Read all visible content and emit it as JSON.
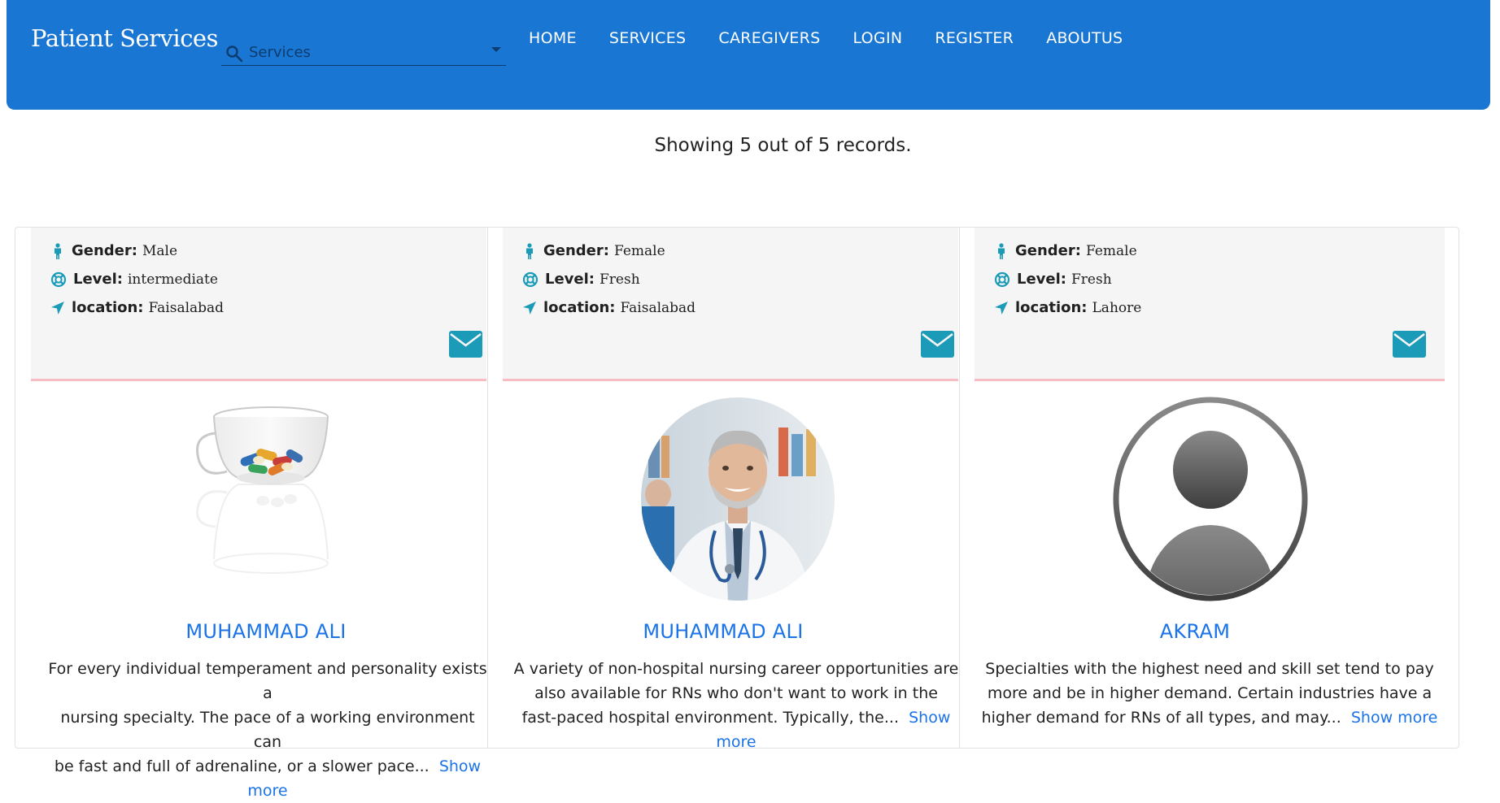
{
  "navbar": {
    "brand": "Patient Services",
    "search_placeholder": "Services",
    "links": [
      "HOME",
      "SERVICES",
      "CAREGIVERS",
      "LOGIN",
      "REGISTER",
      "ABOUTUS"
    ]
  },
  "records_text": "Showing 5 out of 5 records.",
  "labels": {
    "gender": "Gender:",
    "level": "Level:",
    "location": "location:",
    "show_more": "Show more"
  },
  "cards": [
    {
      "gender": "Male",
      "level": "intermediate",
      "location": "Faisalabad",
      "photo": "pills-in-glass-cup",
      "name": "MUHAMMAD ALI",
      "desc_lines": [
        "For every individual temperament and personality exists a",
        "nursing specialty. The pace of a working environment can",
        "be fast and full of adrenaline, or a slower pace..."
      ]
    },
    {
      "gender": "Female",
      "level": "Fresh",
      "location": "Faisalabad",
      "photo": "doctor-portrait",
      "name": "MUHAMMAD ALI",
      "desc_lines": [
        "A variety of non-hospital nursing career opportunities are",
        "also available for RNs who don't want to work in the",
        "fast-paced hospital environment. Typically, the..."
      ]
    },
    {
      "gender": "Female",
      "level": "Fresh",
      "location": "Lahore",
      "photo": "default-avatar",
      "name": "AKRAM",
      "desc_lines": [
        "Specialties with the highest need and skill set tend to pay",
        "more and be in higher demand. Certain industries have a",
        "higher demand for RNs of all types, and may..."
      ]
    }
  ],
  "colors": {
    "navbar": "#1976d2",
    "accent": "#1a73e8",
    "icon_teal": "#1b9bb8",
    "panel_border": "#f8bdc4"
  }
}
